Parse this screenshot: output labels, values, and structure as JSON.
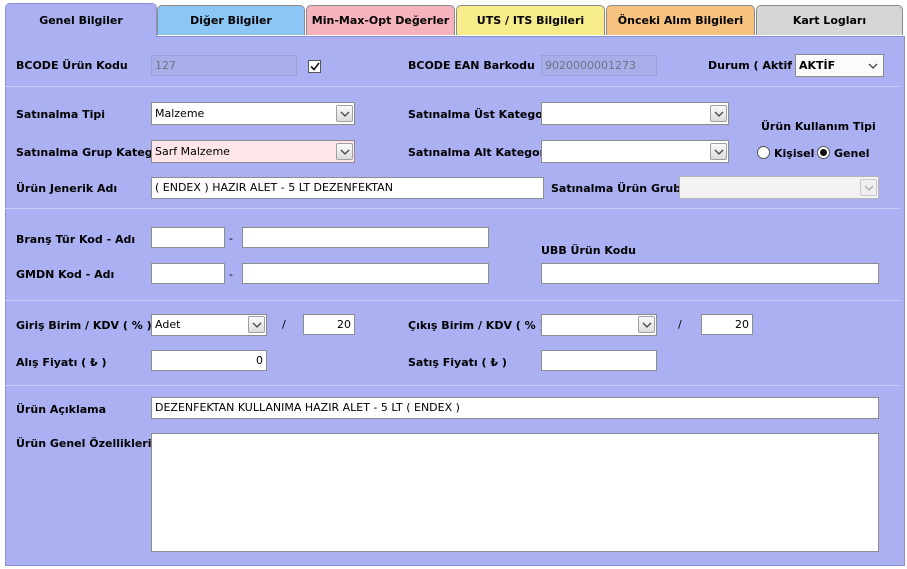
{
  "tabs": [
    {
      "label": "Genel Bilgiler",
      "color": "#aab0f2"
    },
    {
      "label": "Diğer Bilgiler",
      "color": "#8cc6f5"
    },
    {
      "label": "Min-Max-Opt Değerler",
      "color": "#f7b3bd"
    },
    {
      "label": "UTS / ITS Bilgileri",
      "color": "#f6ec8a"
    },
    {
      "label": "Önceki Alım Bilgileri",
      "color": "#f7c27f"
    },
    {
      "label": "Kart Logları",
      "color": "#d6d6d6"
    }
  ],
  "form": {
    "bcode_label": "BCODE Ürün Kodu",
    "bcode_value": "127",
    "ean_label": "BCODE EAN Barkodu",
    "ean_value": "9020000001273",
    "durum_label": "Durum ( Aktif )",
    "durum_value": "AKTİF",
    "satinalma_tipi_label": "Satınalma Tipi",
    "satinalma_tipi_value": "Malzeme",
    "ust_kategori_label": "Satınalma Üst Kategori",
    "ust_kategori_value": "",
    "grup_kategori_label": "Satınalma Grup Kategori",
    "grup_kategori_value": "Sarf Malzeme",
    "alt_kategori_label": "Satınalma Alt Kategori",
    "alt_kategori_value": "",
    "kullanim_tipi_label": "Ürün Kullanım Tipi",
    "kisisel_label": "Kişisel",
    "genel_label": "Genel",
    "jenerik_label": "Ürün Jenerik Adı",
    "jenerik_value": "( ENDEX ) HAZIR ALET - 5 LT DEZENFEKTAN",
    "urun_grubu_label": "Satınalma Ürün Grubu",
    "urun_grubu_value": "",
    "brans_label": "Branş Tür Kod - Adı",
    "gmdn_label": "GMDN Kod - Adı",
    "dash": "-",
    "ubb_label": "UBB Ürün Kodu",
    "ubb_value": "",
    "giris_label": "Giriş Birim / KDV ( % )",
    "giris_birim_value": "Adet",
    "giris_kdv_value": "20",
    "slash": "/",
    "cikis_label": "Çıkış Birim / KDV ( % )",
    "cikis_birim_value": "",
    "cikis_kdv_value": "20",
    "alis_label": "Alış Fiyatı  ( ₺ )",
    "alis_value": "0",
    "satis_label": "Satış Fiyatı  ( ₺ )",
    "satis_value": "",
    "aciklama_label": "Ürün Açıklama",
    "aciklama_value": "DEZENFEKTAN KULLANIMA HAZIR ALET - 5 LT ( ENDEX )",
    "ozellik_label": "Ürün Genel Özellikleri",
    "ozellik_value": ""
  }
}
